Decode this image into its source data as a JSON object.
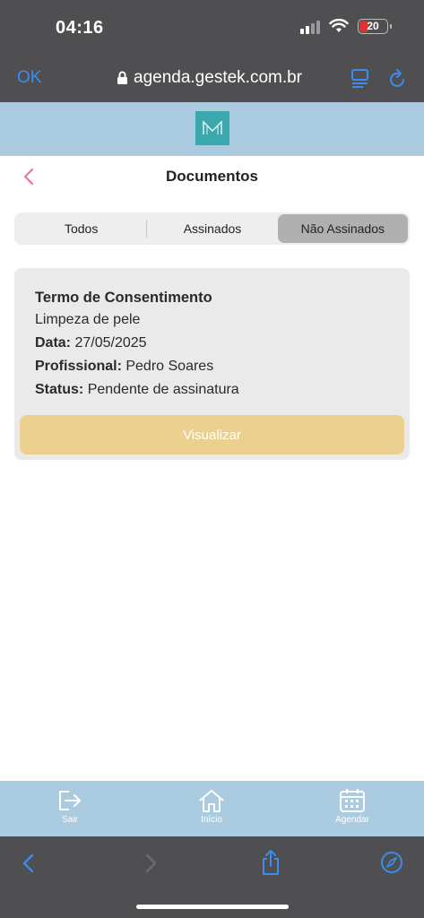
{
  "status": {
    "time": "04:16",
    "battery": "20"
  },
  "browser": {
    "ok_label": "OK",
    "url": "agenda.gestek.com.br"
  },
  "page": {
    "title": "Documentos"
  },
  "tabs": [
    {
      "label": "Todos"
    },
    {
      "label": "Assinados"
    },
    {
      "label": "Não Assinados"
    }
  ],
  "document": {
    "title": "Termo de Consentimento",
    "subtitle": "Limpeza de pele",
    "date_label": "Data:",
    "date_value": "27/05/2025",
    "professional_label": "Profissional:",
    "professional_value": "Pedro Soares",
    "status_label": "Status:",
    "status_value": "Pendente de assinatura",
    "button_label": "Visualizar"
  },
  "nav": [
    {
      "label": "Sair",
      "icon": "logout-icon"
    },
    {
      "label": "Início",
      "icon": "home-icon"
    },
    {
      "label": "Agendar",
      "icon": "calendar-icon"
    }
  ],
  "colors": {
    "accent": "#3b8cf0",
    "header_bg": "#aacbe0",
    "button_bg": "#ecd090",
    "back_chevron": "#e8769a",
    "chrome_bg": "#4f4f51"
  }
}
